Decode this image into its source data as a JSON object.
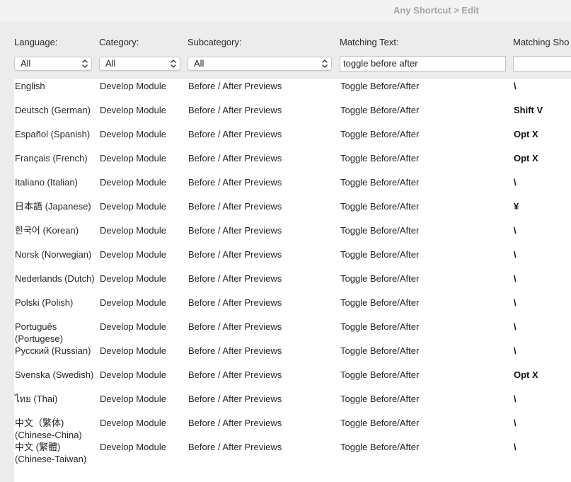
{
  "window": {
    "title": "Any Shortcut > Edit"
  },
  "filters": {
    "language": {
      "label": "Language:",
      "value": "All"
    },
    "category": {
      "label": "Category:",
      "value": "All"
    },
    "subcategory": {
      "label": "Subcategory:",
      "value": "All"
    },
    "matching_text": {
      "label": "Matching Text:",
      "value": "toggle before after"
    },
    "matching_shortcut": {
      "label": "Matching Sho",
      "value": ""
    }
  },
  "rows": [
    {
      "language": "English",
      "category": "Develop Module",
      "subcategory": "Before / After Previews",
      "text": "Toggle Before/After",
      "shortcut": "\\"
    },
    {
      "language": "Deutsch (German)",
      "category": "Develop Module",
      "subcategory": "Before / After Previews",
      "text": "Toggle Before/After",
      "shortcut": "Shift V"
    },
    {
      "language": "Español (Spanish)",
      "category": "Develop Module",
      "subcategory": "Before / After Previews",
      "text": "Toggle Before/After",
      "shortcut": "Opt X"
    },
    {
      "language": "Français (French)",
      "category": "Develop Module",
      "subcategory": "Before / After Previews",
      "text": "Toggle Before/After",
      "shortcut": "Opt X"
    },
    {
      "language": "Italiano (Italian)",
      "category": "Develop Module",
      "subcategory": "Before / After Previews",
      "text": "Toggle Before/After",
      "shortcut": "\\"
    },
    {
      "language": "日本語 (Japanese)",
      "category": "Develop Module",
      "subcategory": "Before / After Previews",
      "text": "Toggle Before/After",
      "shortcut": "¥"
    },
    {
      "language": "한국어 (Korean)",
      "category": "Develop Module",
      "subcategory": "Before / After Previews",
      "text": "Toggle Before/After",
      "shortcut": "\\"
    },
    {
      "language": "Norsk (Norwegian)",
      "category": "Develop Module",
      "subcategory": "Before / After Previews",
      "text": "Toggle Before/After",
      "shortcut": "\\"
    },
    {
      "language": "Nederlands (Dutch)",
      "category": "Develop Module",
      "subcategory": "Before / After Previews",
      "text": "Toggle Before/After",
      "shortcut": "\\"
    },
    {
      "language": "Polski (Polish)",
      "category": "Develop Module",
      "subcategory": "Before / After Previews",
      "text": "Toggle Before/After",
      "shortcut": "\\"
    },
    {
      "language": "Português (Portugese)",
      "category": "Develop Module",
      "subcategory": "Before / After Previews",
      "text": "Toggle Before/After",
      "shortcut": "\\"
    },
    {
      "language": "Русский (Russian)",
      "category": "Develop Module",
      "subcategory": "Before / After Previews",
      "text": "Toggle Before/After",
      "shortcut": "\\"
    },
    {
      "language": "Svenska (Swedish)",
      "category": "Develop Module",
      "subcategory": "Before / After Previews",
      "text": "Toggle Before/After",
      "shortcut": "Opt X"
    },
    {
      "language": "ไทย (Thai)",
      "category": "Develop Module",
      "subcategory": "Before / After Previews",
      "text": "Toggle Before/After",
      "shortcut": "\\"
    },
    {
      "language": "中文（繁体) (Chinese-China)",
      "category": "Develop Module",
      "subcategory": "Before / After Previews",
      "text": "Toggle Before/After",
      "shortcut": "\\"
    },
    {
      "language": "中文 (繁體) (Chinese-Taiwan)",
      "category": "Develop Module",
      "subcategory": "Before / After Previews",
      "text": "Toggle Before/After",
      "shortcut": "\\"
    }
  ]
}
